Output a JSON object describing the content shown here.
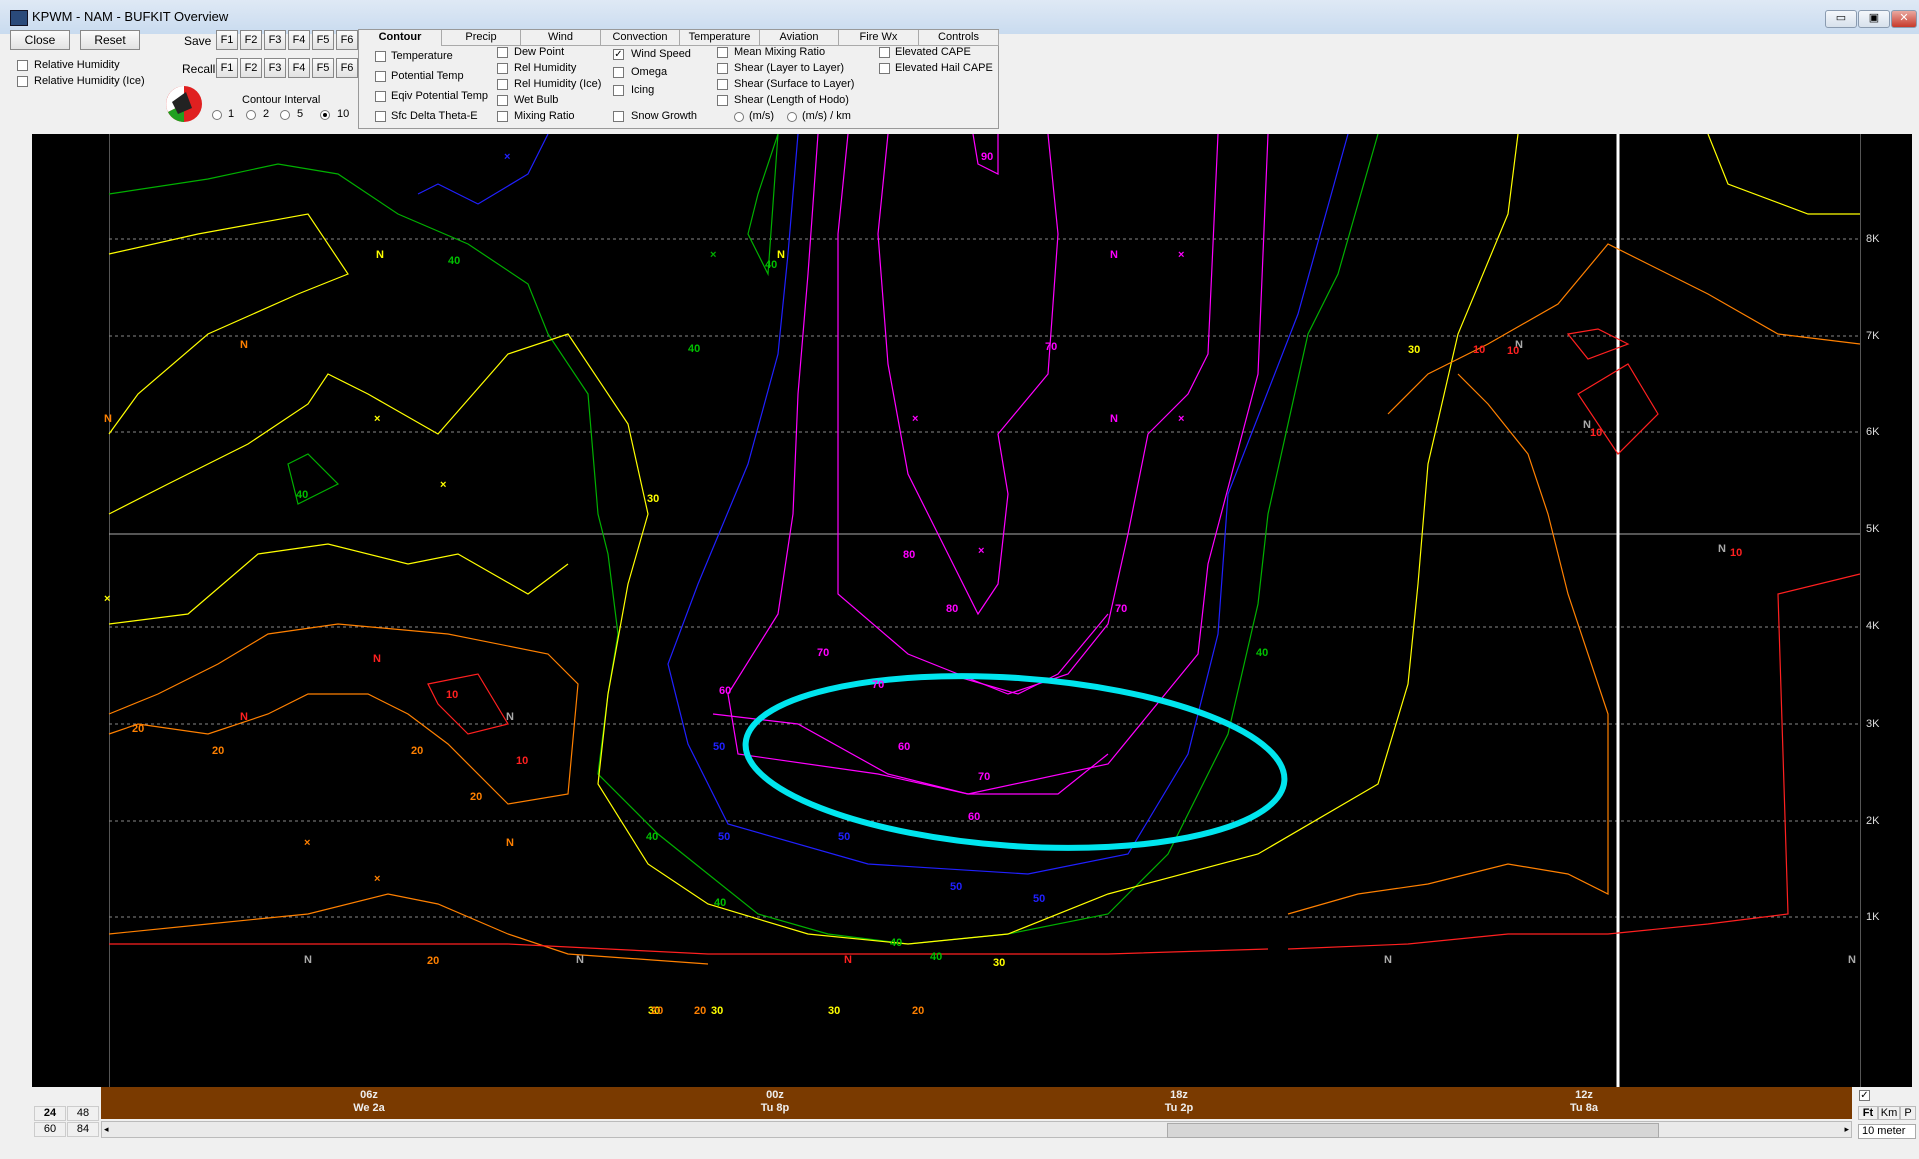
{
  "window": {
    "title": "KPWM - NAM - BUFKIT Overview",
    "min": "▭",
    "max": "▣",
    "close": "✕"
  },
  "left": {
    "close_label": "Close",
    "reset_label": "Reset",
    "rh_label": "Relative Humidity",
    "rh_ice_label": "Relative Humidity (Ice)"
  },
  "saverecall": {
    "save_label": "Save",
    "recall_label": "Recall",
    "keys": [
      "F1",
      "F2",
      "F3",
      "F4",
      "F5",
      "F6"
    ]
  },
  "contour_interval": {
    "label": "Contour Interval",
    "options": [
      "1",
      "2",
      "5",
      "10"
    ],
    "selected": "10"
  },
  "tabs": [
    "Contour",
    "Precip",
    "Wind",
    "Convection",
    "Temperature",
    "Aviation",
    "Fire Wx",
    "Controls"
  ],
  "active_tab": "Contour",
  "contour_options": {
    "col1": [
      "Temperature",
      "Potential Temp",
      "Eqiv Potential Temp",
      "Sfc Delta Theta-E"
    ],
    "col2": [
      "Dew Point",
      "Rel Humidity",
      "Rel Humidity (Ice)",
      "Wet Bulb",
      "Mixing Ratio"
    ],
    "col3": [
      "Wind Speed",
      "Omega",
      "Icing",
      "Snow Growth"
    ],
    "col4": [
      "Mean Mixing Ratio",
      "Shear (Layer to Layer)",
      "Shear (Surface to Layer)",
      "Shear (Length of Hodo)"
    ],
    "col5": [
      "Elevated CAPE",
      "Elevated Hail CAPE"
    ],
    "units": [
      "(m/s)",
      "(m/s) / km"
    ],
    "checked": "Wind Speed"
  },
  "altitudes": [
    "8K",
    "7K",
    "6K",
    "5K",
    "4K",
    "3K",
    "2K",
    "1K"
  ],
  "timeline": [
    {
      "z": "06z",
      "local": "We 2a"
    },
    {
      "z": "00z",
      "local": "Tu 8p"
    },
    {
      "z": "18z",
      "local": "Tu 2p"
    },
    {
      "z": "12z",
      "local": "Tu 8a"
    }
  ],
  "hours": {
    "row1": [
      "24",
      "48"
    ],
    "row2": [
      "60",
      "84"
    ]
  },
  "units_toggle": [
    "Ft",
    "Km",
    "P"
  ],
  "sfc_label": "10 meter",
  "colors": {
    "wind10": "#ff2020",
    "wind20": "#ff8000",
    "wind30": "#ffff00",
    "wind40": "#00c000",
    "wind50": "#2020ff",
    "wind60": "#ff00ff",
    "wind70": "#ff00ff",
    "wind80": "#ff00ff",
    "wind90": "#ff00ff",
    "highlight": "#00e5ee"
  },
  "contour_labels": [
    {
      "t": "90",
      "c": "wind90"
    },
    {
      "t": "80",
      "c": "wind80"
    },
    {
      "t": "80",
      "c": "wind80"
    },
    {
      "t": "70",
      "c": "wind70"
    },
    {
      "t": "70",
      "c": "wind70"
    },
    {
      "t": "70",
      "c": "wind70"
    },
    {
      "t": "70",
      "c": "wind70"
    },
    {
      "t": "70",
      "c": "wind70"
    },
    {
      "t": "60",
      "c": "wind60"
    },
    {
      "t": "60",
      "c": "wind60"
    },
    {
      "t": "60",
      "c": "wind60"
    },
    {
      "t": "50",
      "c": "wind50"
    },
    {
      "t": "50",
      "c": "wind50"
    },
    {
      "t": "50",
      "c": "wind50"
    },
    {
      "t": "50",
      "c": "wind50"
    },
    {
      "t": "50",
      "c": "wind50"
    },
    {
      "t": "40",
      "c": "wind40"
    },
    {
      "t": "40",
      "c": "wind40"
    },
    {
      "t": "40",
      "c": "wind40"
    },
    {
      "t": "40",
      "c": "wind40"
    },
    {
      "t": "40",
      "c": "wind40"
    },
    {
      "t": "40",
      "c": "wind40"
    },
    {
      "t": "40",
      "c": "wind40"
    },
    {
      "t": "40",
      "c": "wind40"
    },
    {
      "t": "40",
      "c": "wind40"
    },
    {
      "t": "30",
      "c": "wind30"
    },
    {
      "t": "30",
      "c": "wind30"
    },
    {
      "t": "30",
      "c": "wind30"
    },
    {
      "t": "30",
      "c": "wind30"
    },
    {
      "t": "30",
      "c": "wind30"
    },
    {
      "t": "30",
      "c": "wind30"
    },
    {
      "t": "20",
      "c": "wind20"
    },
    {
      "t": "20",
      "c": "wind20"
    },
    {
      "t": "20",
      "c": "wind20"
    },
    {
      "t": "20",
      "c": "wind20"
    },
    {
      "t": "20",
      "c": "wind20"
    },
    {
      "t": "20",
      "c": "wind20"
    },
    {
      "t": "20",
      "c": "wind20"
    },
    {
      "t": "20",
      "c": "wind20"
    },
    {
      "t": "10",
      "c": "wind10"
    },
    {
      "t": "10",
      "c": "wind10"
    },
    {
      "t": "10",
      "c": "wind10"
    },
    {
      "t": "10",
      "c": "wind10"
    },
    {
      "t": "10",
      "c": "wind10"
    },
    {
      "t": "10",
      "c": "wind10"
    }
  ]
}
